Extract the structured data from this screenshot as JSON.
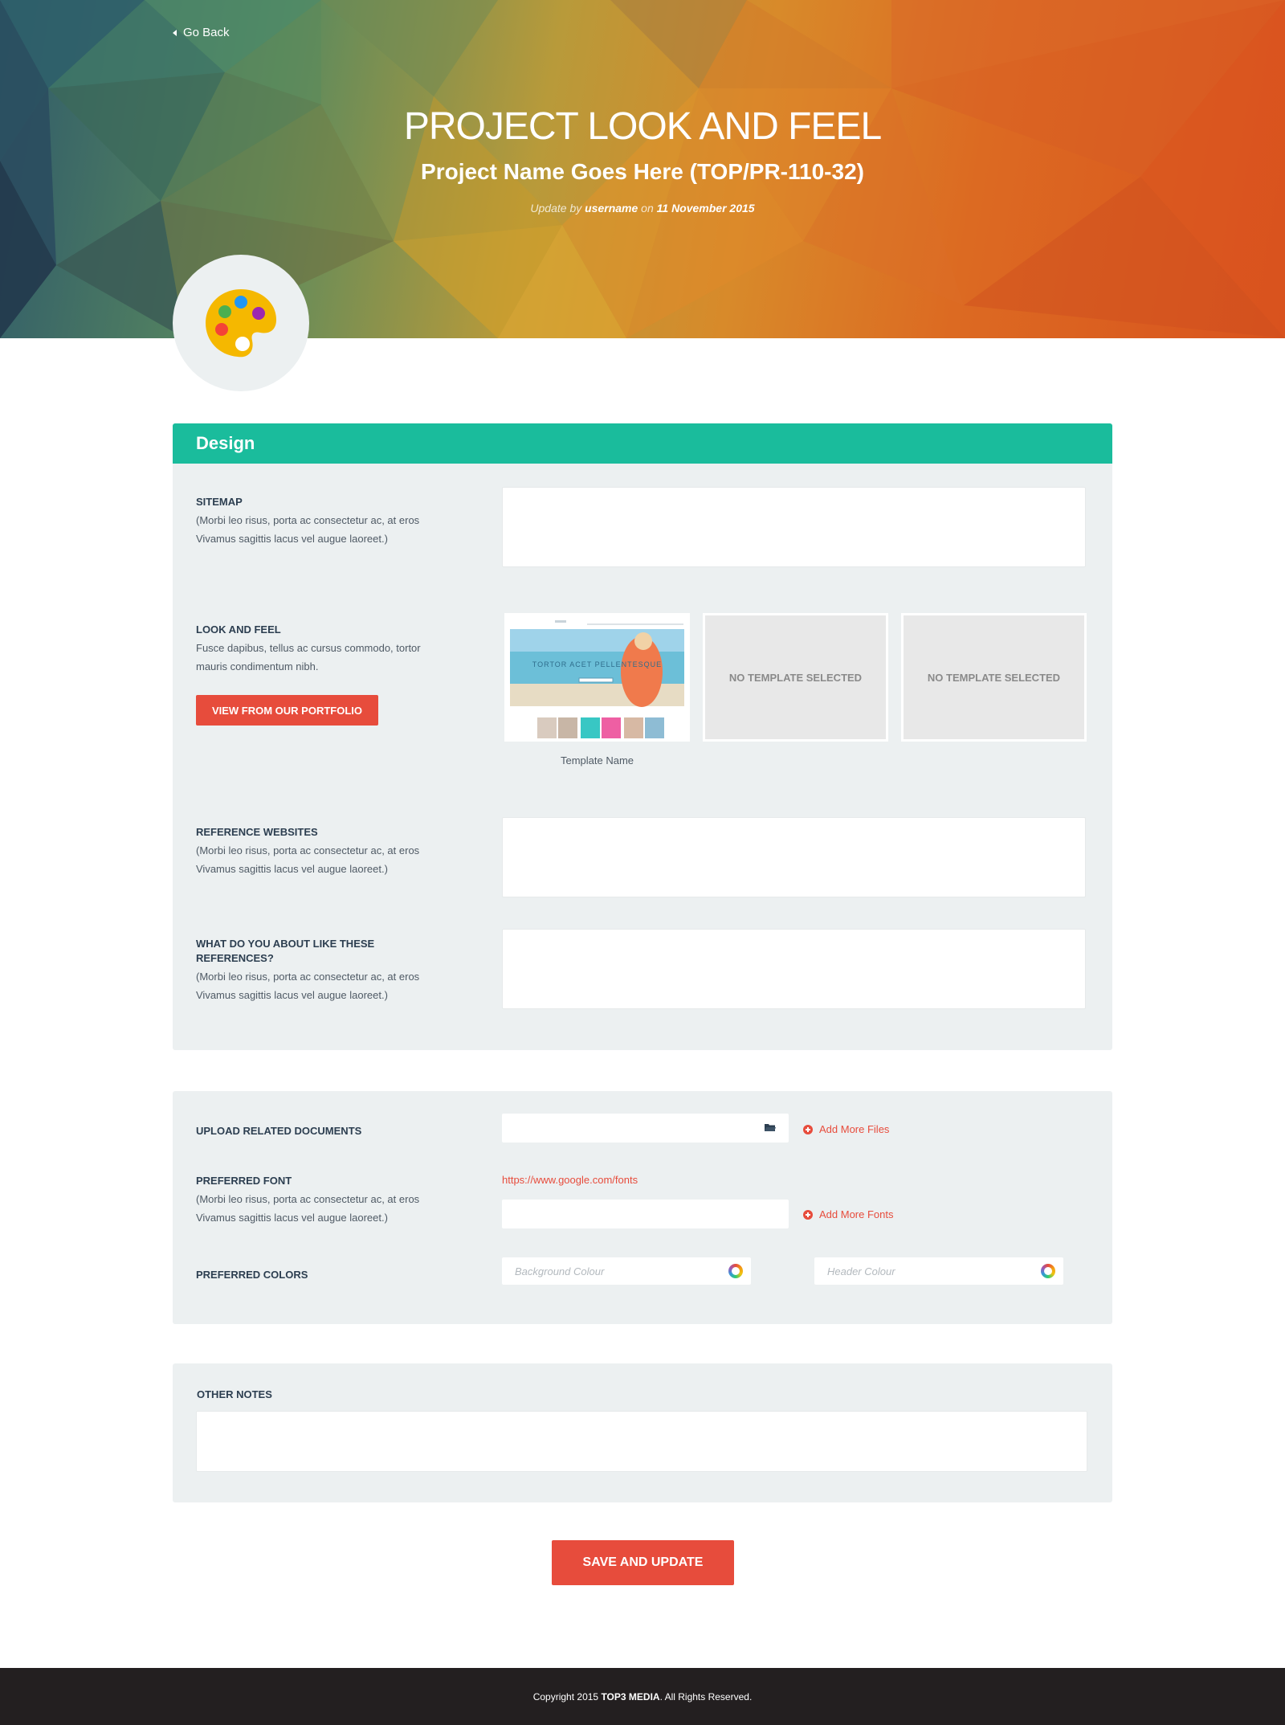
{
  "nav": {
    "go_back": "Go Back"
  },
  "hero": {
    "title": "PROJECT  LOOK AND FEEL",
    "subtitle": "Project Name Goes Here (TOP/PR-110-32)",
    "meta_prefix": "Update by ",
    "meta_user": "username",
    "meta_on": " on ",
    "meta_date": "11 November 2015"
  },
  "design": {
    "heading": "Design",
    "sitemap": {
      "title": "SITEMAP",
      "desc": "(Morbi leo risus, porta ac consectetur ac, at eros Vivamus sagittis lacus vel augue laoreet.)"
    },
    "look_feel": {
      "title": "LOOK AND FEEL",
      "desc": "Fusce dapibus, tellus ac cursus commodo, tortor mauris condimentum nibh.",
      "button": "VIEW FROM OUR PORTFOLIO",
      "template_caption": "Template Name",
      "thumb_heading": "TORTOR ACET PELLENTESQUE",
      "empty_slot_1": "NO TEMPLATE SELECTED",
      "empty_slot_2": "NO TEMPLATE SELECTED"
    },
    "reference_websites": {
      "title": "REFERENCE WEBSITES",
      "desc": "(Morbi leo risus, porta ac consectetur ac, at eros Vivamus sagittis lacus vel augue laoreet.)"
    },
    "references_like": {
      "title": "WHAT DO YOU ABOUT  LIKE THESE REFERENCES?",
      "desc": "(Morbi leo risus, porta ac consectetur ac, at eros Vivamus sagittis lacus vel augue laoreet.)"
    }
  },
  "assets": {
    "upload": {
      "title": "UPLOAD RELATED DOCUMENTS",
      "add_more": "Add More Files",
      "icon": "folder-icon"
    },
    "font": {
      "title": "PREFERRED FONT",
      "desc": "(Morbi leo risus, porta ac consectetur ac, at eros Vivamus sagittis lacus vel augue laoreet.)",
      "link": "https://www.google.com/fonts",
      "add_more": "Add More Fonts"
    },
    "colors": {
      "title": "PREFERRED COLORS",
      "background_placeholder": "Background Colour",
      "header_placeholder": "Header Colour"
    }
  },
  "notes": {
    "title": "OTHER NOTES"
  },
  "actions": {
    "save": "SAVE AND UPDATE"
  },
  "footer": {
    "prefix": "Copyright 2015 ",
    "brand": "TOP3 MEDIA",
    "suffix": ". All Rights Reserved."
  },
  "colors": {
    "accent_green": "#1abc9c",
    "accent_red": "#e74c3c",
    "panel_bg": "#ecf0f1",
    "footer_bg": "#231f20"
  }
}
